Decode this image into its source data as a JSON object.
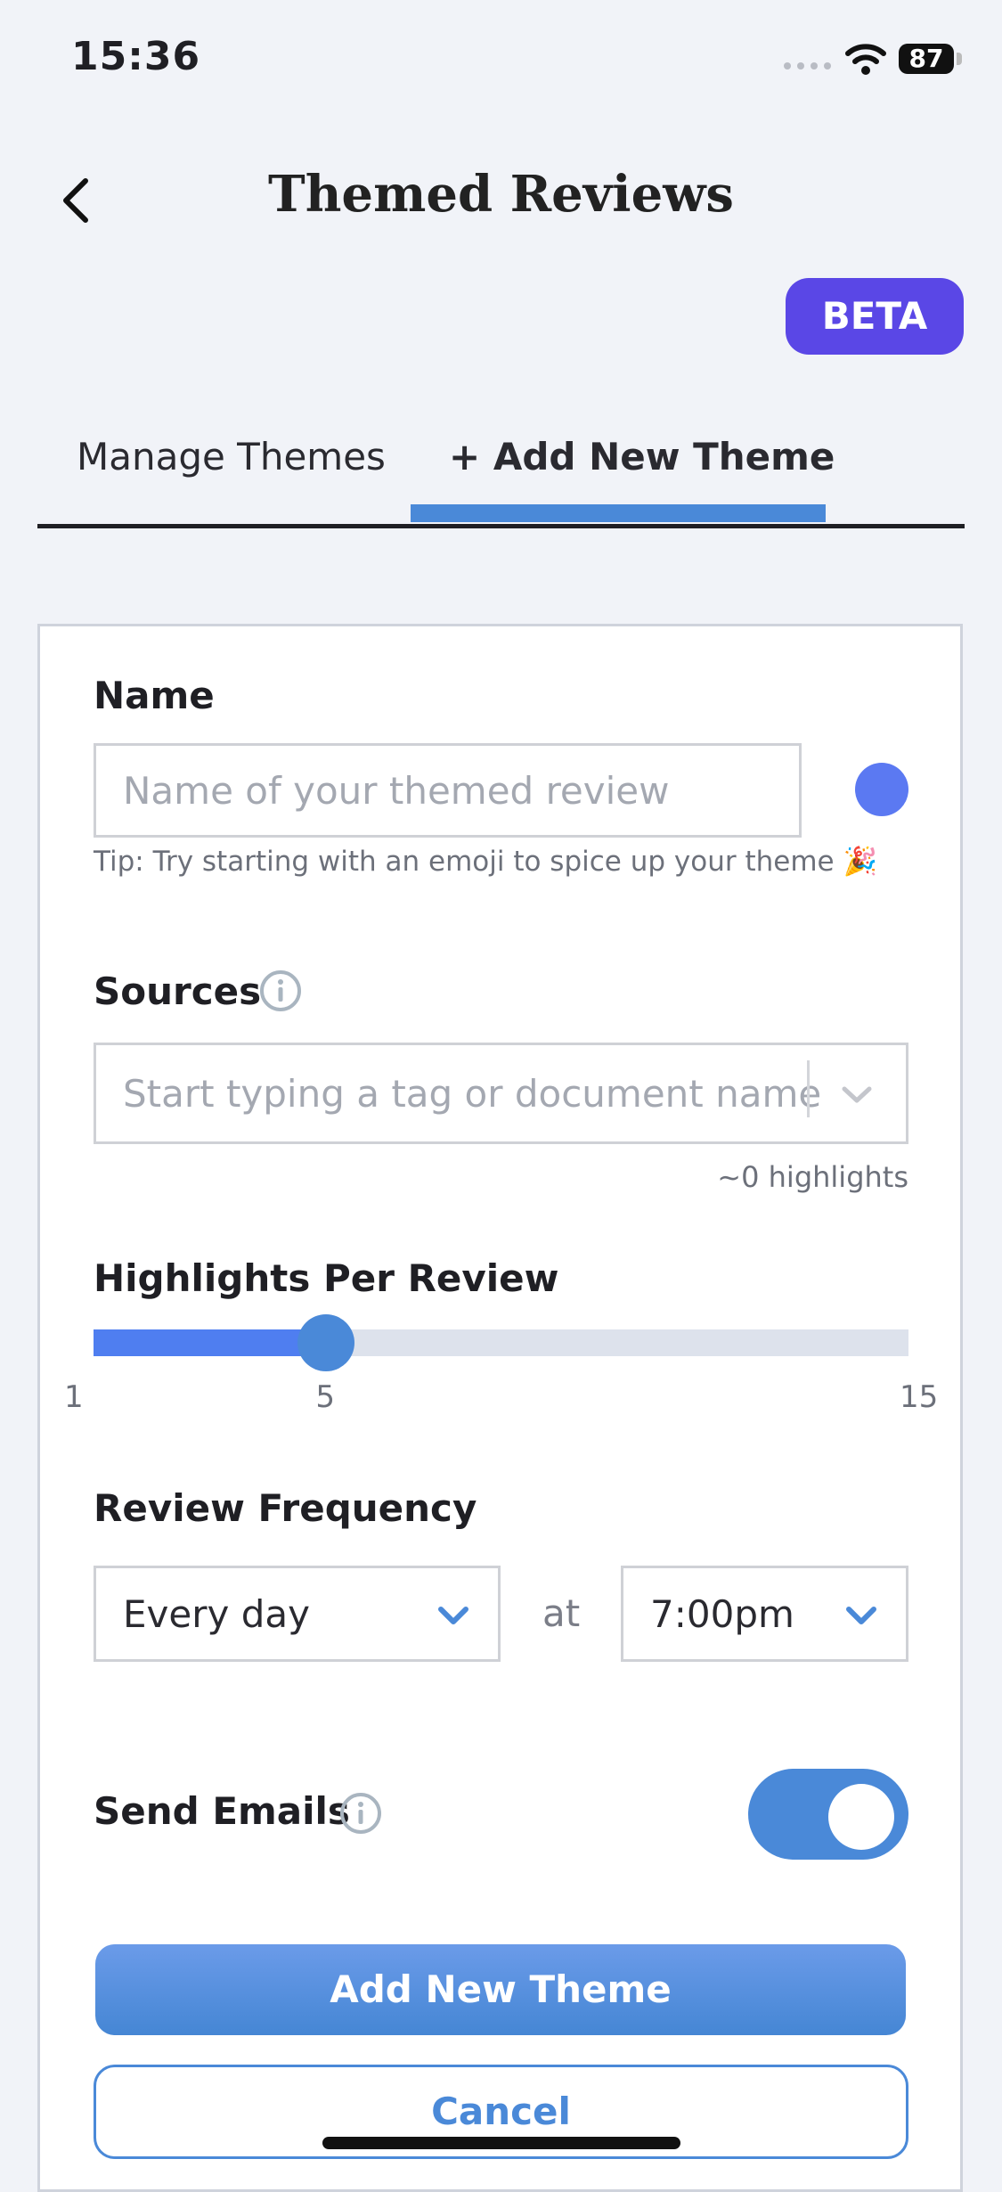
{
  "status_bar": {
    "time": "15:36",
    "battery": "87"
  },
  "header": {
    "title": "Themed Reviews",
    "badge": "BETA"
  },
  "tabs": [
    {
      "label": "Manage Themes",
      "active": false
    },
    {
      "label": "+ Add New Theme",
      "active": true
    }
  ],
  "form": {
    "name": {
      "label": "Name",
      "placeholder": "Name of your themed review",
      "tip": "Tip: Try starting with an emoji to spice up your theme 🎉",
      "color": "#5b79f2"
    },
    "sources": {
      "label": "Sources",
      "placeholder": "Start typing a tag or document name",
      "count": "~0 highlights"
    },
    "highlights_per_review": {
      "label": "Highlights Per Review",
      "min": 1,
      "max": 15,
      "value": 5,
      "tick_min": "1",
      "tick_value": "5",
      "tick_max": "15"
    },
    "review_frequency": {
      "label": "Review Frequency",
      "frequency": "Every day",
      "at": "at",
      "time": "7:00pm"
    },
    "send_emails": {
      "label": "Send Emails",
      "enabled": true
    }
  },
  "actions": {
    "primary": "Add New Theme",
    "secondary": "Cancel"
  },
  "colors": {
    "accent": "#4a89d8",
    "beta": "#5a47e6",
    "slider_fill": "#4f7ef0"
  }
}
